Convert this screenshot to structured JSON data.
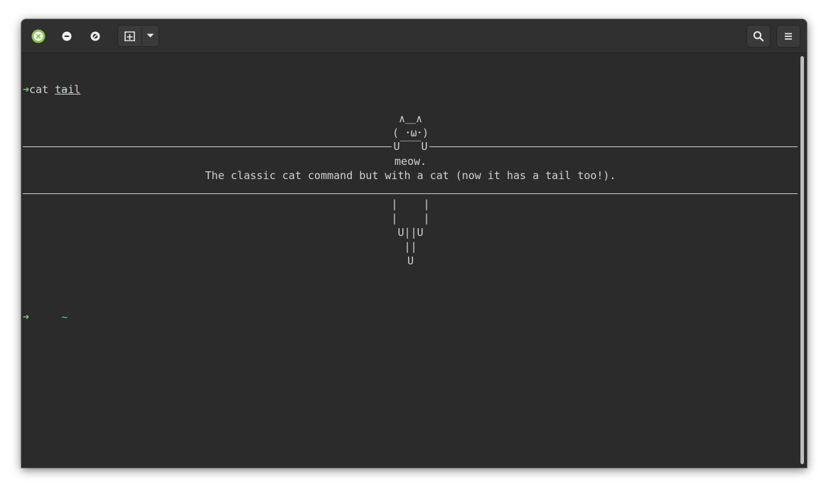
{
  "titlebar": {
    "buttons": {
      "close": "close-icon",
      "minimize": "minimize-icon",
      "maximize": "maximize-icon",
      "new_tab": "new-tab-icon",
      "dropdown": "chevron-down-icon",
      "search": "search-icon",
      "menu": "hamburger-menu-icon"
    }
  },
  "terminal": {
    "prompt_dir": "~",
    "prompt_symbol": "➜",
    "command": "cat",
    "argument": "tail",
    "art": {
      "ears": "∧＿∧",
      "face": "( ･ω･)",
      "paws": "U￣￣U",
      "meow": "meow.",
      "message": "The classic cat command but with a cat (now it has a tail too!).",
      "legs1": "|    |",
      "legs2": "|    |",
      "feet": "U||U",
      "tail": "||",
      "tail_end": "U"
    },
    "prompt2_dir": "~",
    "prompt2_symbol": "➜"
  },
  "colors": {
    "background": "#2b2b2b",
    "titlebar": "#303030",
    "text": "#d0d0d0",
    "prompt_dir": "#5fbfb0",
    "prompt_arrow": "#7dc97d",
    "close_button": "#7cb342"
  }
}
